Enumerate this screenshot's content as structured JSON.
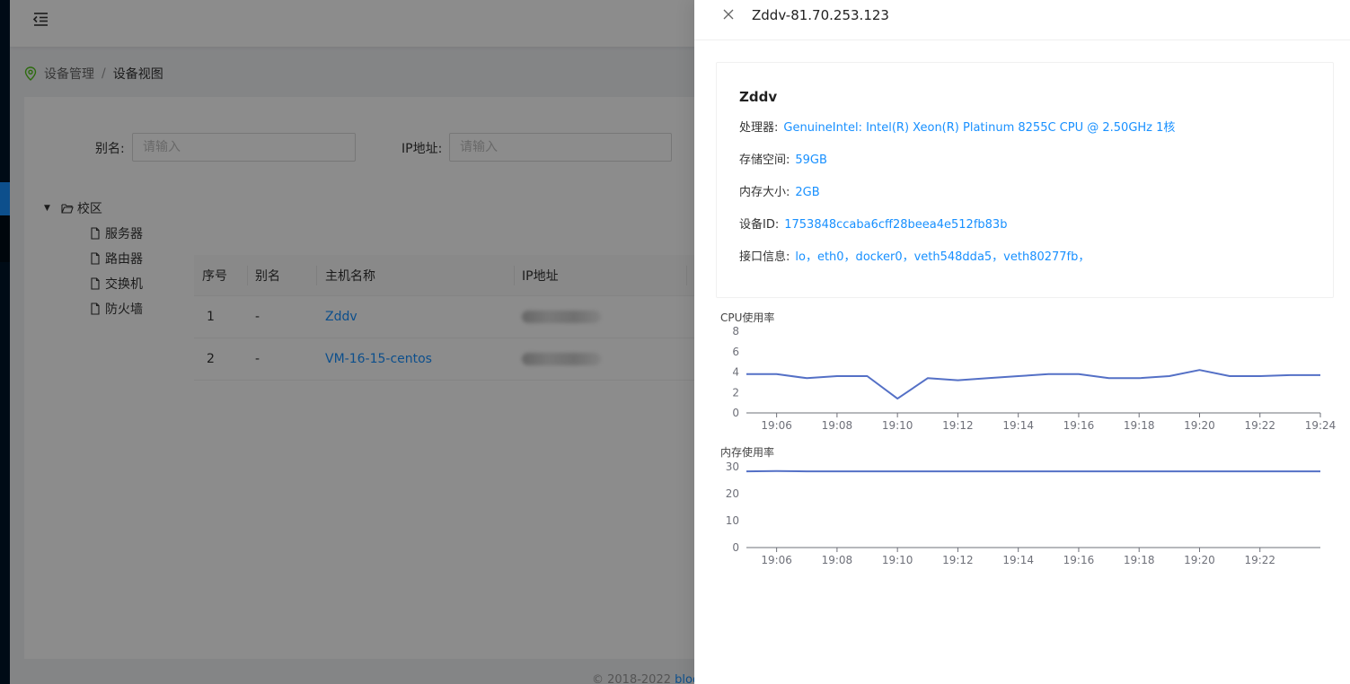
{
  "app": {
    "footer_prefix": "© 2018-2022",
    "footer_link": "blog"
  },
  "header": {
    "menu_icon": "menu-fold-icon"
  },
  "breadcrumb": {
    "items": [
      "设备管理",
      "设备视图"
    ],
    "separator": "/"
  },
  "filters": {
    "alias": {
      "label": "别名:",
      "placeholder": "请输入",
      "value": ""
    },
    "ip": {
      "label": "IP地址:",
      "placeholder": "请输入",
      "value": ""
    }
  },
  "tree": {
    "root": {
      "label": "校区",
      "icon": "folder-open-icon"
    },
    "children": [
      {
        "label": "服务器",
        "icon": "file-icon"
      },
      {
        "label": "路由器",
        "icon": "file-icon"
      },
      {
        "label": "交换机",
        "icon": "file-icon"
      },
      {
        "label": "防火墙",
        "icon": "file-icon"
      }
    ]
  },
  "table": {
    "columns": [
      "序号",
      "别名",
      "主机名称",
      "IP地址"
    ],
    "rows": [
      {
        "index": "1",
        "alias": "-",
        "hostname": "Zddv",
        "ip": ""
      },
      {
        "index": "2",
        "alias": "-",
        "hostname": "VM-16-15-centos",
        "ip": ""
      }
    ]
  },
  "drawer": {
    "title": "Zddv-81.70.253.123",
    "host": "Zddv",
    "info": [
      {
        "key": "处理器:",
        "value": "GenuineIntel: Intel(R) Xeon(R) Platinum 8255C CPU @ 2.50GHz 1核"
      },
      {
        "key": "存储空间:",
        "value": "59GB"
      },
      {
        "key": "内存大小:",
        "value": "2GB"
      },
      {
        "key": "设备ID:",
        "value": "1753848ccaba6cff28beea4e512fb83b"
      },
      {
        "key": "接口信息:",
        "value": "lo，eth0，docker0，veth548dda5，veth80277fb，"
      }
    ]
  },
  "colors": {
    "accent": "#1890ff",
    "series": "#5470c6",
    "sidebar": "#001529"
  },
  "chart_data": [
    {
      "type": "line",
      "title": "CPU使用率",
      "x": [
        "19:05",
        "19:06",
        "19:07",
        "19:08",
        "19:09",
        "19:10",
        "19:11",
        "19:12",
        "19:13",
        "19:14",
        "19:15",
        "19:16",
        "19:17",
        "19:18",
        "19:19",
        "19:20",
        "19:21",
        "19:22",
        "19:23",
        "19:24"
      ],
      "x_tick_labels": [
        "19:06",
        "19:08",
        "19:10",
        "19:12",
        "19:14",
        "19:16",
        "19:18",
        "19:20",
        "19:22",
        "19:24"
      ],
      "values": [
        3.8,
        3.8,
        3.4,
        3.6,
        3.6,
        1.4,
        3.4,
        3.2,
        3.4,
        3.6,
        3.8,
        3.8,
        3.4,
        3.4,
        3.6,
        4.2,
        3.6,
        3.6,
        3.7,
        3.7
      ],
      "ylim": [
        0,
        8
      ],
      "y_ticks": [
        0,
        2,
        4,
        6,
        8
      ],
      "grid": false
    },
    {
      "type": "line",
      "title": "内存使用率",
      "x": [
        "19:05",
        "19:06",
        "19:07",
        "19:08",
        "19:09",
        "19:10",
        "19:11",
        "19:12",
        "19:13",
        "19:14",
        "19:15",
        "19:16",
        "19:17",
        "19:18",
        "19:19",
        "19:20",
        "19:21",
        "19:22",
        "19:23",
        "19:24"
      ],
      "x_tick_labels": [
        "19:06",
        "19:08",
        "19:10",
        "19:12",
        "19:14",
        "19:16",
        "19:18",
        "19:20",
        "19:22"
      ],
      "values": [
        28.3,
        28.4,
        28.3,
        28.3,
        28.3,
        28.3,
        28.3,
        28.3,
        28.3,
        28.3,
        28.3,
        28.3,
        28.3,
        28.3,
        28.3,
        28.3,
        28.3,
        28.3,
        28.3,
        28.3
      ],
      "ylim": [
        0,
        30
      ],
      "y_ticks": [
        0,
        10,
        20,
        30
      ],
      "grid": false
    }
  ]
}
